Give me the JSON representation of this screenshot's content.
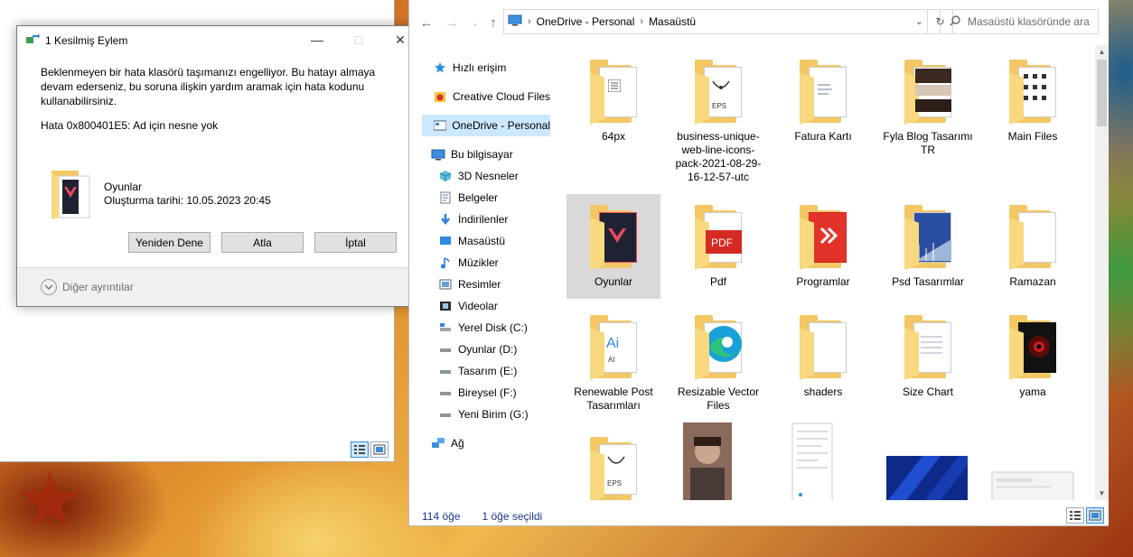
{
  "dialog": {
    "title": "1 Kesilmiş Eylem",
    "message": "Beklenmeyen bir hata klasörü taşımanızı engelliyor. Bu hatayı almaya devam ederseniz, bu soruna ilişkin yardım aramak için hata kodunu kullanabilirsiniz.",
    "error": "Hata 0x800401E5: Ad için nesne yok",
    "file_name": "Oyunlar",
    "file_date": "Oluşturma tarihi: 10.05.2023 20:45",
    "retry_label": "Yeniden Dene",
    "skip_label": "Atla",
    "cancel_label": "İptal",
    "details_label": "Diğer ayrıntılar"
  },
  "explorer": {
    "breadcrumb": [
      "OneDrive - Personal",
      "Masaüstü"
    ],
    "search_placeholder": "Masaüstü klasöründe ara",
    "nav": {
      "quick_access": "Hızlı erişim",
      "creative_cloud": "Creative Cloud Files",
      "onedrive": "OneDrive - Personal",
      "this_pc": "Bu bilgisayar",
      "objects3d": "3D Nesneler",
      "documents": "Belgeler",
      "downloads": "İndirilenler",
      "desktop": "Masaüstü",
      "music": "Müzikler",
      "pictures": "Resimler",
      "videos": "Videolar",
      "disk_c": "Yerel Disk (C:)",
      "disk_d": "Oyunlar (D:)",
      "disk_e": "Tasarım (E:)",
      "disk_f": "Bireysel (F:)",
      "disk_g": "Yeni Birim (G:)",
      "network": "Ağ"
    },
    "items": [
      "64px",
      "business-unique-web-line-icons-pack-2021-08-29-16-12-57-utc",
      "Fatura Kartı",
      "Fyla Blog Tasarımı TR",
      "Main Files",
      "Oyunlar",
      "Pdf",
      "Programlar",
      "Psd Tasarımlar",
      "Ramazan",
      "Renewable Post Tasarımları",
      "Resizable Vector Files",
      "shaders",
      "Size Chart",
      "yama"
    ],
    "status_count": "114 öğe",
    "status_selected": "1 öğe seçildi"
  }
}
